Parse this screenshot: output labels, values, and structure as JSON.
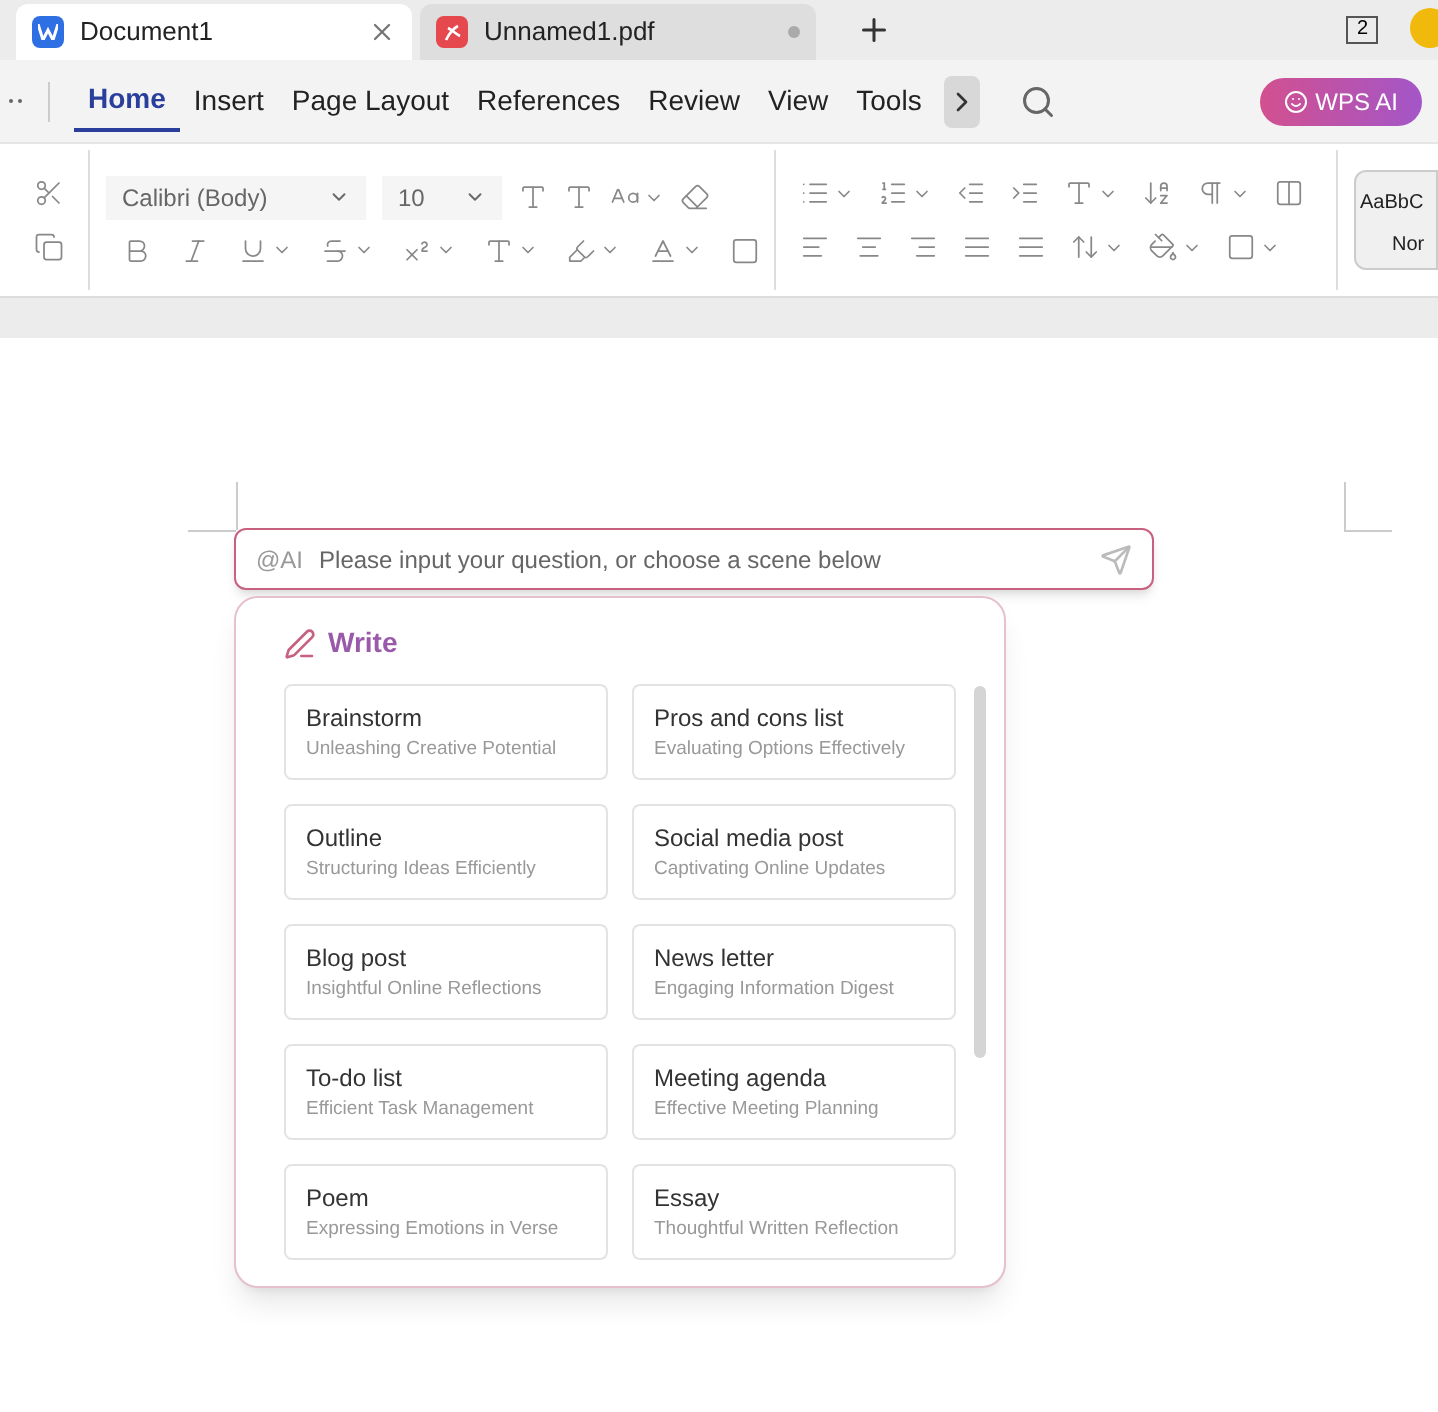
{
  "tabs": [
    {
      "label": "Document1",
      "kind": "writer",
      "selected": true
    },
    {
      "label": "Unnamed1.pdf",
      "kind": "pdf",
      "selected": false
    }
  ],
  "window_count": "2",
  "menu": [
    {
      "label": "Home",
      "selected": true
    },
    {
      "label": "Insert",
      "selected": false
    },
    {
      "label": "Page Layout",
      "selected": false
    },
    {
      "label": "References",
      "selected": false
    },
    {
      "label": "Review",
      "selected": false
    },
    {
      "label": "View",
      "selected": false
    },
    {
      "label": "Tools",
      "selected": false
    }
  ],
  "ai_button": "WPS AI",
  "font_name": "Calibri (Body)",
  "font_size": "10",
  "style_preview": {
    "sample": "AaBbC",
    "name": "Nor"
  },
  "ai_input": {
    "prefix": "@AI",
    "placeholder": "Please input your question, or choose a scene below"
  },
  "write_title": "Write",
  "scenes": [
    {
      "title": "Brainstorm",
      "subtitle": "Unleashing Creative Potential"
    },
    {
      "title": "Pros and cons list",
      "subtitle": "Evaluating Options Effectively"
    },
    {
      "title": "Outline",
      "subtitle": "Structuring Ideas Efficiently"
    },
    {
      "title": "Social media post",
      "subtitle": "Captivating Online Updates"
    },
    {
      "title": "Blog post",
      "subtitle": "Insightful Online Reflections"
    },
    {
      "title": "News letter",
      "subtitle": "Engaging Information Digest"
    },
    {
      "title": "To-do list",
      "subtitle": "Efficient Task Management"
    },
    {
      "title": "Meeting agenda",
      "subtitle": "Effective Meeting Planning"
    },
    {
      "title": "Poem",
      "subtitle": "Expressing Emotions in Verse"
    },
    {
      "title": "Essay",
      "subtitle": "Thoughtful Written Reflection"
    }
  ]
}
